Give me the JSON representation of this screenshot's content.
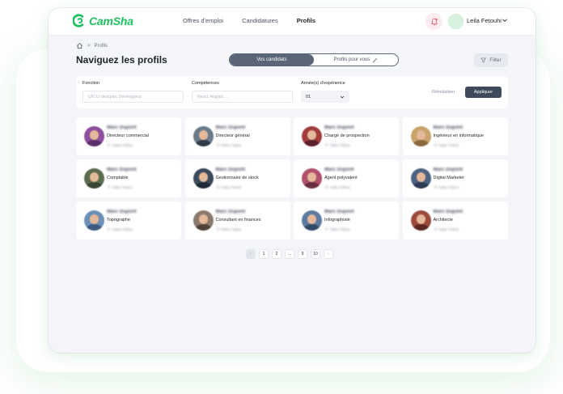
{
  "app": {
    "logo_text": "CamSha",
    "brand_color": "#1fbf5f"
  },
  "nav": {
    "items": [
      {
        "label": "Offres d'emploi",
        "active": false
      },
      {
        "label": "Candidatures",
        "active": false
      },
      {
        "label": "Profils",
        "active": true
      }
    ]
  },
  "user": {
    "name": "Leila Fetouhi"
  },
  "breadcrumb": {
    "separator": ">",
    "current": "Profils"
  },
  "page": {
    "title": "Naviguez les profils"
  },
  "toggle": {
    "left": "Vos candidats",
    "right": "Profils pour vous",
    "selected": "Vos candidats"
  },
  "filter_button": {
    "label": "Filter"
  },
  "filters": {
    "fonction": {
      "label": "Fonction",
      "placeholder": "UX/ UI designer, Développeur"
    },
    "competences": {
      "label": "Compétences",
      "placeholder": "React, Anglais, ..."
    },
    "experience": {
      "label": "Année(s) d'expérience",
      "value": "01"
    },
    "reset_label": "Réinitialiser",
    "apply_label": "Appliquer"
  },
  "profiles": [
    {
      "name": "Marc Dupont",
      "role": "Directeur commercial",
      "location": "Nabu Paksa"
    },
    {
      "name": "Marc Dupont",
      "role": "Directeur général",
      "location": "Nabu Paksa"
    },
    {
      "name": "Marc Dupont",
      "role": "Chargé de prospection",
      "location": "Nabu Paksa"
    },
    {
      "name": "Marc Dupont",
      "role": "Ingénieur en informatique",
      "location": "Nabu Paksa"
    },
    {
      "name": "Marc Dupont",
      "role": "Comptable",
      "location": "Nabu Paksa"
    },
    {
      "name": "Marc Dupont",
      "role": "Gestionnaire de stock",
      "location": "Nabu Paksa"
    },
    {
      "name": "Marc Dupont",
      "role": "Agent polyvalent",
      "location": "Nabu Paksa"
    },
    {
      "name": "Marc Dupont",
      "role": "Digital Marketer",
      "location": "Nabu Paksa"
    },
    {
      "name": "Marc Dupont",
      "role": "Topographe",
      "location": "Nabu Paksa"
    },
    {
      "name": "Marc Dupont",
      "role": "Consultant en finances",
      "location": "Nabu Paksa"
    },
    {
      "name": "Marc Dupont",
      "role": "Infographiste",
      "location": "Nabu Paksa"
    },
    {
      "name": "Marc Dupont",
      "role": "Architecte",
      "location": "Nabu Paksa"
    }
  ],
  "avatar_colors": [
    [
      "#8e4f9c",
      "#5a2f6a"
    ],
    [
      "#6b7b8a",
      "#2f3a46"
    ],
    [
      "#a23c3c",
      "#5a1f2a"
    ],
    [
      "#c9a36b",
      "#8a6a3d"
    ],
    [
      "#5c6b4e",
      "#3a4632"
    ],
    [
      "#3c4a5c",
      "#1f2a38"
    ],
    [
      "#b0506a",
      "#6a2f3f"
    ],
    [
      "#4d6280",
      "#2a3a52"
    ],
    [
      "#6c8fb8",
      "#3c5a80"
    ],
    [
      "#8a7a6e",
      "#4f4236"
    ],
    [
      "#5d7aa0",
      "#33496a"
    ],
    [
      "#9c4a3c",
      "#5a2a22"
    ]
  ],
  "pagination": {
    "pages": [
      "1",
      "2",
      "...",
      "9",
      "10"
    ],
    "prev": "‹",
    "next": "›"
  }
}
